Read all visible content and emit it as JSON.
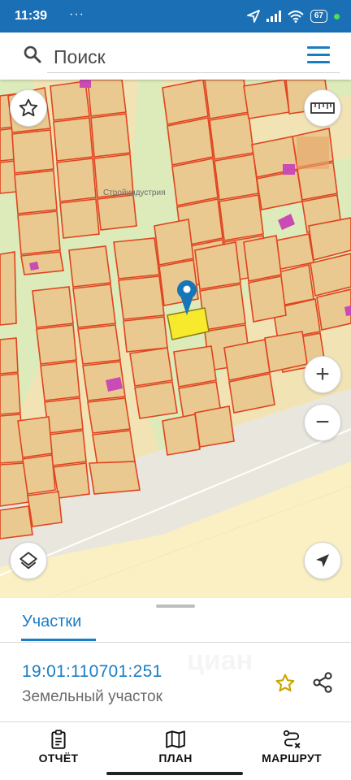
{
  "status_bar": {
    "time": "11:39",
    "dots": "···",
    "battery": "67",
    "color": "#1a6fb5"
  },
  "search": {
    "placeholder": "Поиск",
    "icon": "search-icon",
    "menu_icon": "menu-icon"
  },
  "map": {
    "place_label": "Стройиндустрия",
    "controls": [
      "star-icon",
      "ruler-icon",
      "zoom-in-icon",
      "zoom-out-icon",
      "layers-icon",
      "locate-icon"
    ],
    "zoom_in_label": "+",
    "zoom_out_label": "−",
    "colors": {
      "background": "#f2e3b4",
      "parcel_fill": "#e9c98f",
      "parcel_border": "#e0431f",
      "green_area": "#dcebb9",
      "road": "#fbf0c4",
      "building": "#c94bb3",
      "selected_parcel": "#f7ea2d",
      "marker": "#1676b7"
    }
  },
  "sheet": {
    "tab_label": "Участки",
    "cadastral_number": "19:01:110701:251",
    "plot_type": "Земельный участок",
    "watermark": "циан",
    "accent": "#1a7dc4"
  },
  "nav": {
    "items": [
      {
        "label": "ОТЧЁТ",
        "icon": "report-icon"
      },
      {
        "label": "ПЛАН",
        "icon": "map-icon"
      },
      {
        "label": "МАРШРУТ",
        "icon": "route-icon"
      }
    ]
  }
}
